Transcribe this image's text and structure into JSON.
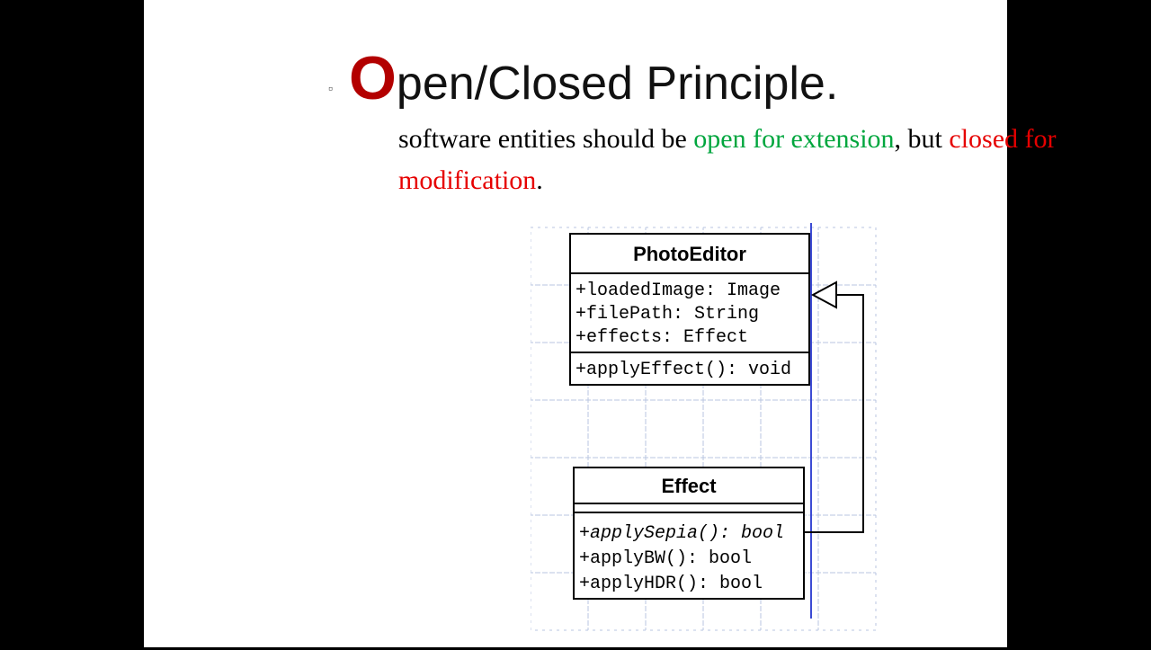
{
  "bullet": "▫",
  "title": {
    "first": "O",
    "rest": "pen/Closed Principle."
  },
  "definition": {
    "part1": "software entities should be ",
    "green": "open for extension",
    "part2": ", but ",
    "red": "closed for modification",
    "part3": "."
  },
  "classes": {
    "photoEditor": {
      "name": "PhotoEditor",
      "attrs": [
        "+loadedImage: Image",
        "+filePath: String",
        "+effects: Effect"
      ],
      "ops": [
        "+applyEffect(): void"
      ]
    },
    "effect": {
      "name": "Effect",
      "ops": [
        {
          "text": "+applySepia(): bool",
          "ital": true
        },
        {
          "text": "+applyBW(): bool",
          "ital": false
        },
        {
          "text": "+applyHDR(): bool",
          "ital": false
        }
      ]
    }
  }
}
